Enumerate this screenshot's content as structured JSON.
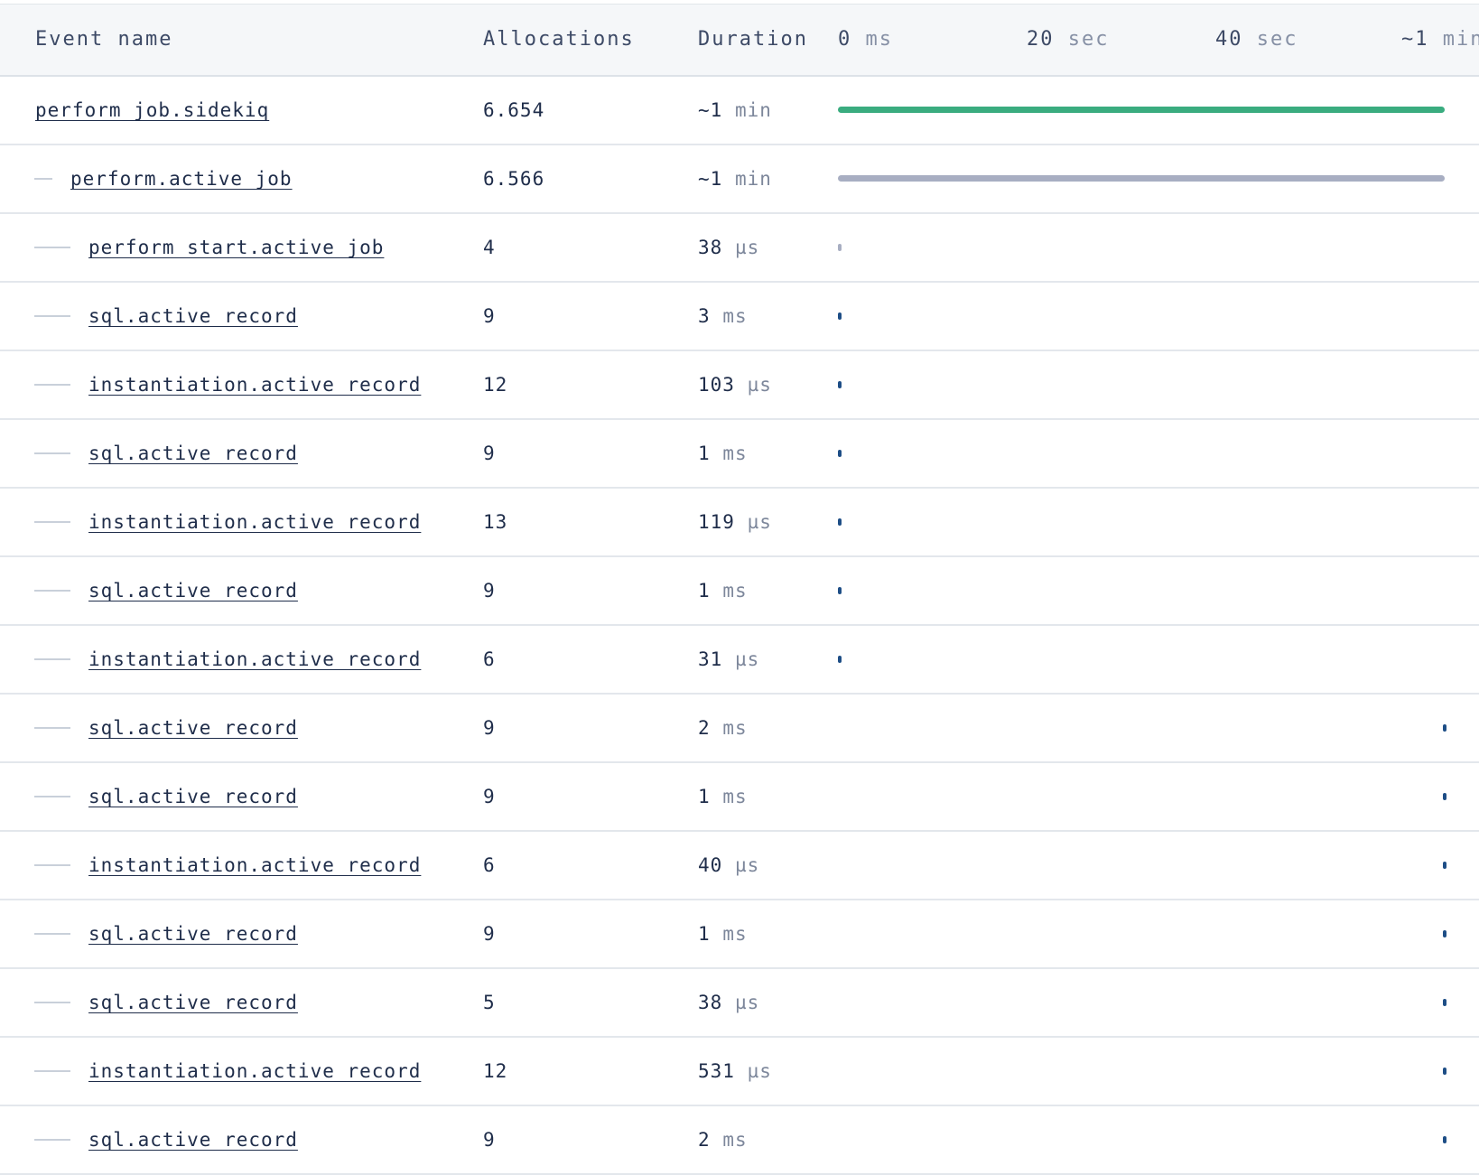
{
  "header": {
    "event_name": "Event name",
    "allocations": "Allocations",
    "duration": "Duration",
    "ticks": [
      {
        "num": "0",
        "unit": "ms"
      },
      {
        "num": "20",
        "unit": "sec"
      },
      {
        "num": "40",
        "unit": "sec"
      },
      {
        "num": "~1",
        "unit": "min"
      }
    ]
  },
  "colors": {
    "root_bar": "#3aac7f",
    "child_bar": "#a8aec2",
    "leaf_mark": "#1e4e86",
    "start_mark": "#a8aec2"
  },
  "rows": [
    {
      "name": "perform_job.sidekiq",
      "depth": 0,
      "allocations": "6.654",
      "duration_num": "~1",
      "duration_unit": "min",
      "start": 0.0,
      "end": 1.0,
      "style": "root_bar"
    },
    {
      "name": "perform.active_job",
      "depth": 1,
      "allocations": "6.566",
      "duration_num": "~1",
      "duration_unit": "min",
      "start": 0.0,
      "end": 1.0,
      "style": "child_bar"
    },
    {
      "name": "perform_start.active_job",
      "depth": 2,
      "allocations": "4",
      "duration_num": "38",
      "duration_unit": "µs",
      "start": 0.0,
      "end": 0.0,
      "style": "start_mark"
    },
    {
      "name": "sql.active_record",
      "depth": 2,
      "allocations": "9",
      "duration_num": "3",
      "duration_unit": "ms",
      "start": 0.0,
      "end": 0.0,
      "style": "leaf_mark"
    },
    {
      "name": "instantiation.active_record",
      "depth": 2,
      "allocations": "12",
      "duration_num": "103",
      "duration_unit": "µs",
      "start": 0.0,
      "end": 0.0,
      "style": "leaf_mark"
    },
    {
      "name": "sql.active_record",
      "depth": 2,
      "allocations": "9",
      "duration_num": "1",
      "duration_unit": "ms",
      "start": 0.0,
      "end": 0.0,
      "style": "leaf_mark"
    },
    {
      "name": "instantiation.active_record",
      "depth": 2,
      "allocations": "13",
      "duration_num": "119",
      "duration_unit": "µs",
      "start": 0.0,
      "end": 0.0,
      "style": "leaf_mark"
    },
    {
      "name": "sql.active_record",
      "depth": 2,
      "allocations": "9",
      "duration_num": "1",
      "duration_unit": "ms",
      "start": 0.0,
      "end": 0.0,
      "style": "leaf_mark"
    },
    {
      "name": "instantiation.active_record",
      "depth": 2,
      "allocations": "6",
      "duration_num": "31",
      "duration_unit": "µs",
      "start": 0.0,
      "end": 0.0,
      "style": "leaf_mark"
    },
    {
      "name": "sql.active_record",
      "depth": 2,
      "allocations": "9",
      "duration_num": "2",
      "duration_unit": "ms",
      "start": 1.0,
      "end": 1.0,
      "style": "leaf_mark"
    },
    {
      "name": "sql.active_record",
      "depth": 2,
      "allocations": "9",
      "duration_num": "1",
      "duration_unit": "ms",
      "start": 1.0,
      "end": 1.0,
      "style": "leaf_mark"
    },
    {
      "name": "instantiation.active_record",
      "depth": 2,
      "allocations": "6",
      "duration_num": "40",
      "duration_unit": "µs",
      "start": 1.0,
      "end": 1.0,
      "style": "leaf_mark"
    },
    {
      "name": "sql.active_record",
      "depth": 2,
      "allocations": "9",
      "duration_num": "1",
      "duration_unit": "ms",
      "start": 1.0,
      "end": 1.0,
      "style": "leaf_mark"
    },
    {
      "name": "sql.active_record",
      "depth": 2,
      "allocations": "5",
      "duration_num": "38",
      "duration_unit": "µs",
      "start": 1.0,
      "end": 1.0,
      "style": "leaf_mark"
    },
    {
      "name": "instantiation.active_record",
      "depth": 2,
      "allocations": "12",
      "duration_num": "531",
      "duration_unit": "µs",
      "start": 1.0,
      "end": 1.0,
      "style": "leaf_mark"
    },
    {
      "name": "sql.active_record",
      "depth": 2,
      "allocations": "9",
      "duration_num": "2",
      "duration_unit": "ms",
      "start": 1.0,
      "end": 1.0,
      "style": "leaf_mark"
    }
  ]
}
